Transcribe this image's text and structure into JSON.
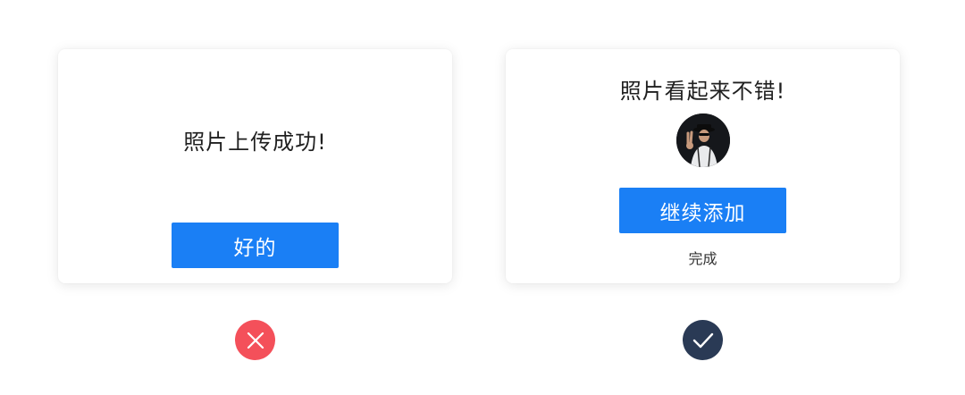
{
  "left_dialog": {
    "message": "照片上传成功!",
    "ok_button_label": "好的"
  },
  "right_dialog": {
    "message": "照片看起来不错!",
    "avatar_icon": "user-photo-avatar",
    "continue_button_label": "继续添加",
    "done_label": "完成"
  },
  "verdicts": {
    "left": {
      "icon": "close-icon",
      "color": "#f4505a",
      "meaning": "incorrect"
    },
    "right": {
      "icon": "check-icon",
      "color": "#2a3a55",
      "meaning": "correct"
    }
  },
  "colors": {
    "primary_button": "#1a7ff5",
    "text": "#1f1f1f"
  }
}
